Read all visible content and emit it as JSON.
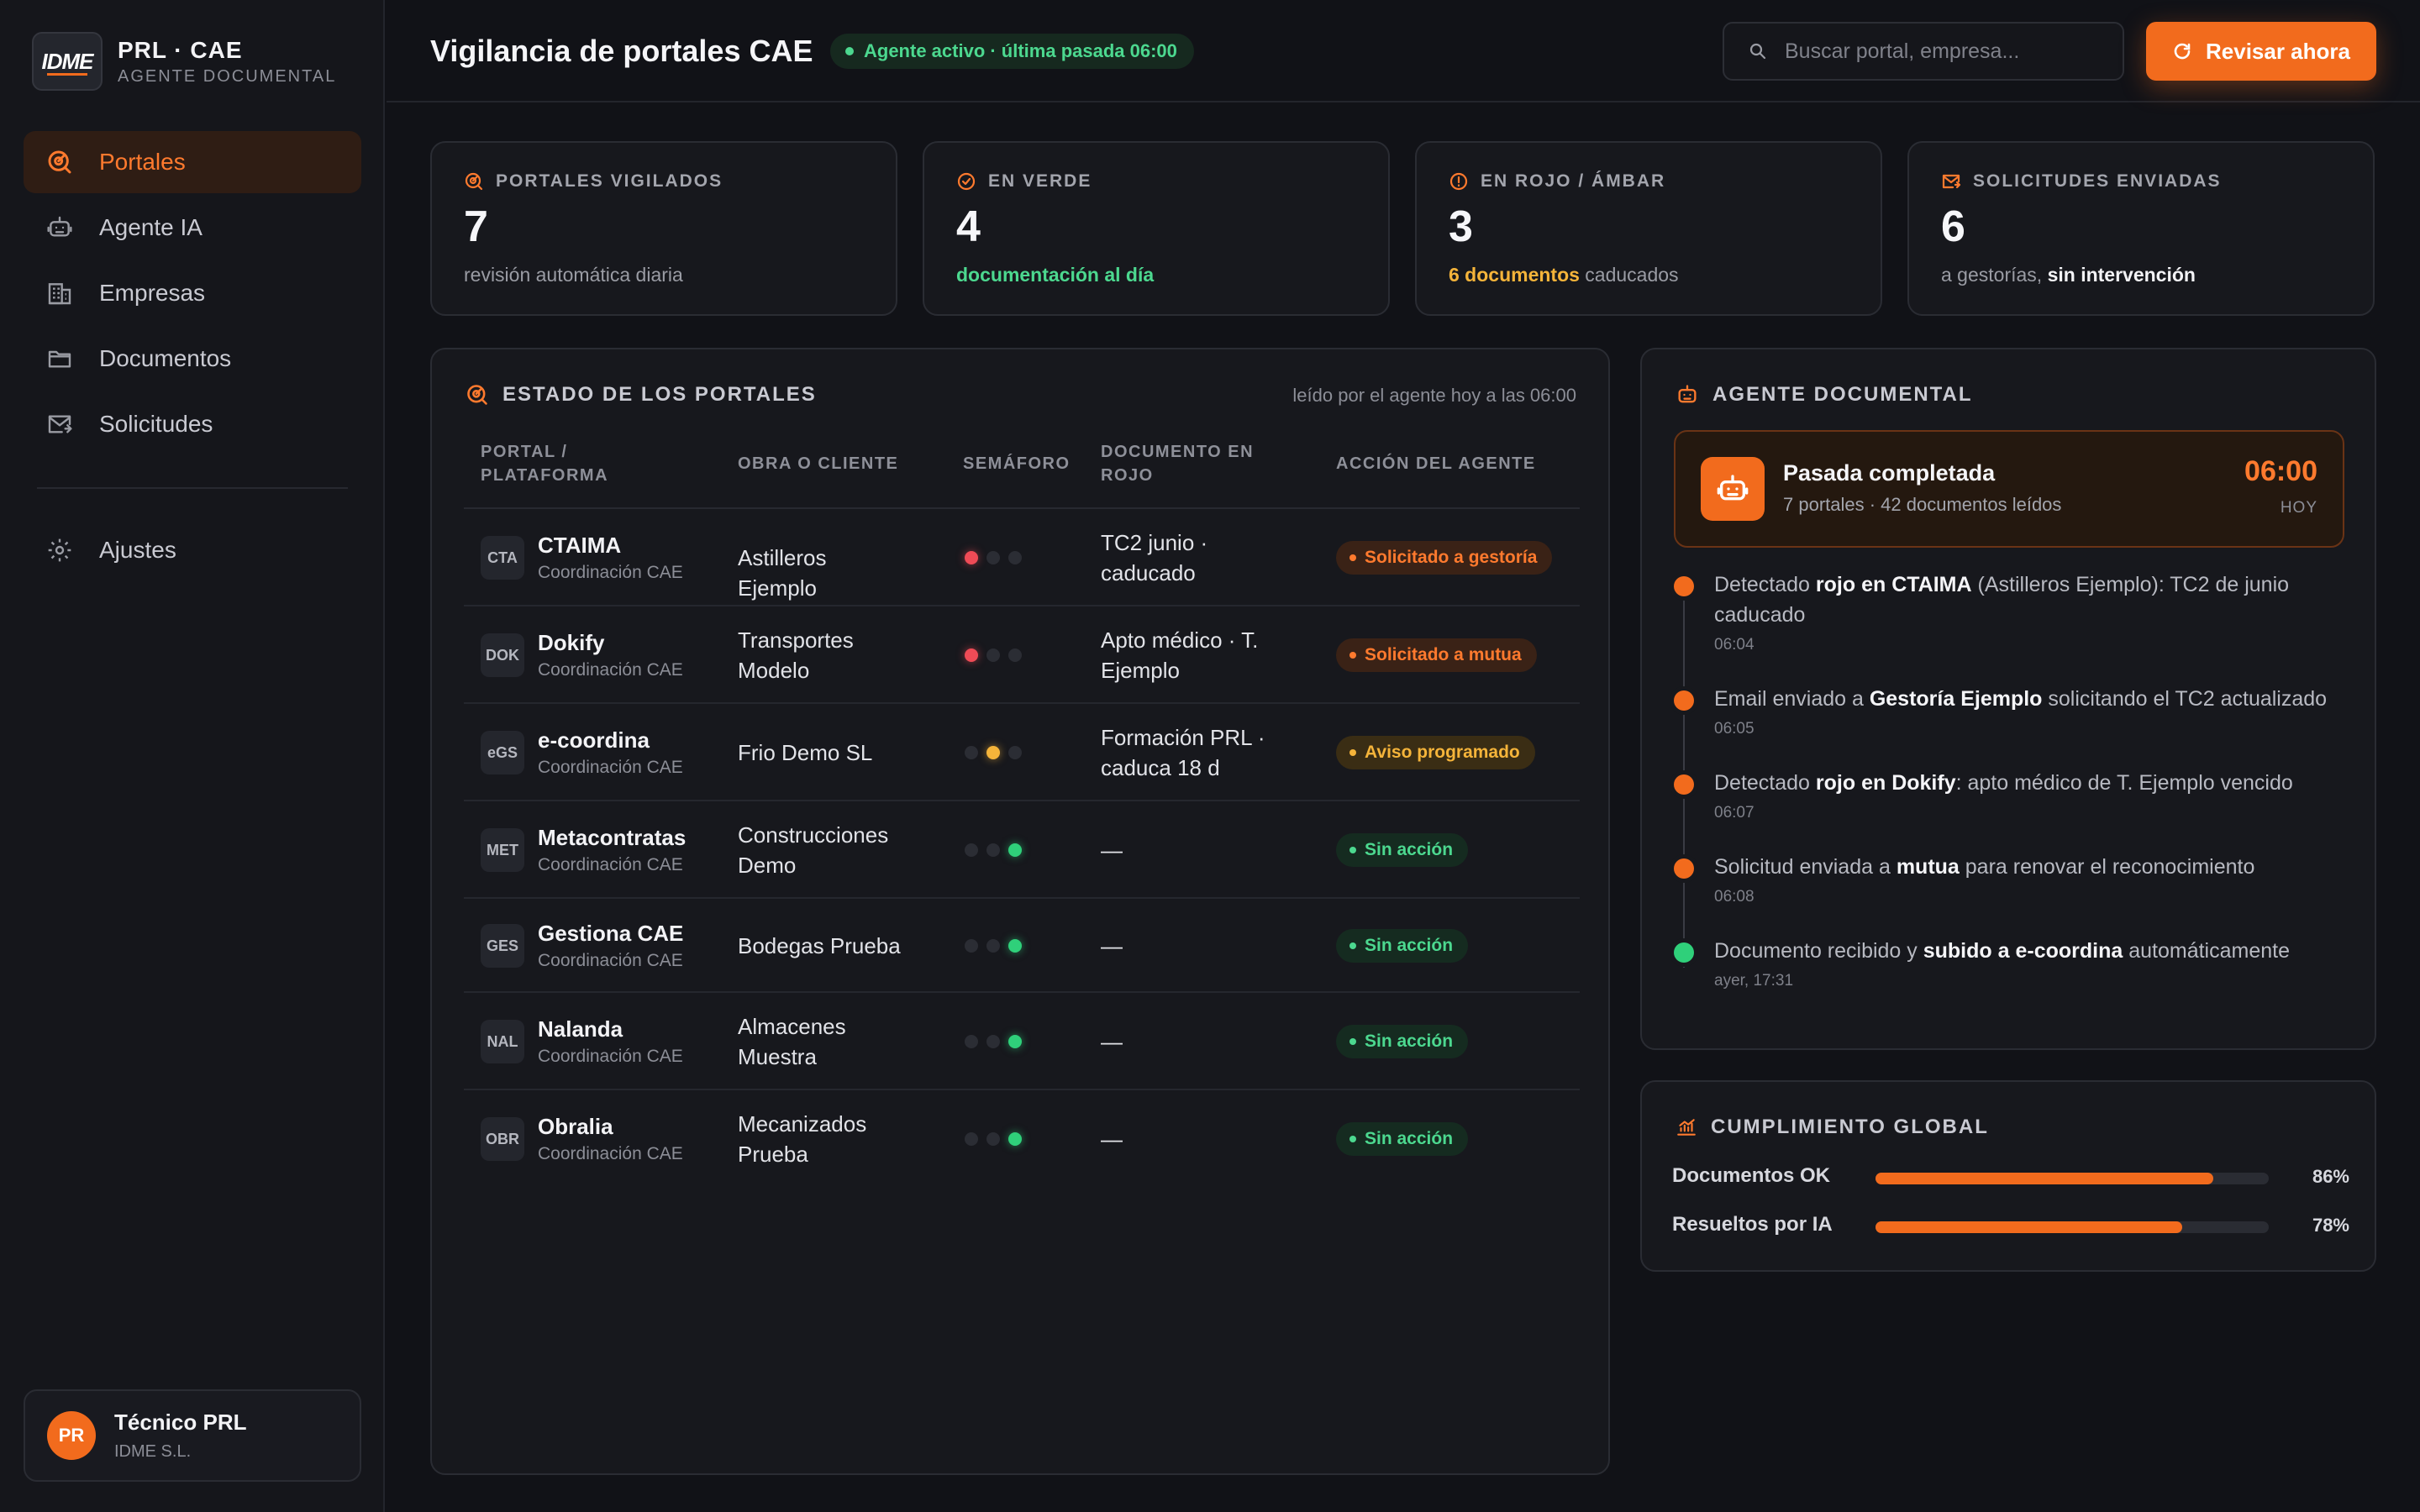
{
  "brand": {
    "logo": "IDME",
    "title": "PRL · CAE",
    "subtitle": "AGENTE DOCUMENTAL"
  },
  "sidebar": {
    "items": [
      {
        "label": "Portales",
        "icon": "radar-icon",
        "active": true
      },
      {
        "label": "Agente IA",
        "icon": "robot-icon"
      },
      {
        "label": "Empresas",
        "icon": "building-icon"
      },
      {
        "label": "Documentos",
        "icon": "folder-icon"
      },
      {
        "label": "Solicitudes",
        "icon": "mail-send-icon"
      }
    ],
    "settings_label": "Ajustes"
  },
  "user": {
    "initials": "PR",
    "name": "Técnico PRL",
    "org": "IDME S.L."
  },
  "header": {
    "title": "Vigilancia de portales CAE",
    "status": "Agente activo · última pasada 06:00",
    "search_placeholder": "Buscar portal, empresa...",
    "primary_action": "Revisar ahora"
  },
  "kpis": [
    {
      "label": "PORTALES VIGILADOS",
      "value": "7",
      "note": "revisión automática diaria"
    },
    {
      "label": "EN VERDE",
      "value": "4",
      "note": "documentación al día"
    },
    {
      "label": "EN ROJO / ÁMBAR",
      "value": "3",
      "note_strong": "6 documentos",
      "note_rest": " caducados"
    },
    {
      "label": "SOLICITUDES ENVIADAS",
      "value": "6",
      "note_rest": "a gestorías, ",
      "note_strong": "sin intervención"
    }
  ],
  "portals": {
    "title": "ESTADO DE LOS PORTALES",
    "meta": "leído por el agente hoy a las 06:00",
    "columns": {
      "portal_1": "PORTAL /",
      "portal_2": "PLATAFORMA",
      "client": "OBRA O CLIENTE",
      "light": "SEMÁFORO",
      "doc_1": "DOCUMENTO EN",
      "doc_2": "ROJO",
      "action": "ACCIÓN DEL AGENTE"
    },
    "rows": [
      {
        "code": "CTA",
        "name": "CTAIMA",
        "platform": "Coordinación CAE",
        "client": "Astilleros Ejemplo",
        "light": "red",
        "doc": "TC2 junio · caducado",
        "action": "Solicitado a gestoría",
        "action_tone": "orange"
      },
      {
        "code": "DOK",
        "name": "Dokify",
        "platform": "Coordinación CAE",
        "client": "Transportes Modelo",
        "light": "red",
        "doc": "Apto médico · T. Ejemplo",
        "action": "Solicitado a mutua",
        "action_tone": "orange"
      },
      {
        "code": "eGS",
        "name": "e-coordina",
        "platform": "Coordinación CAE",
        "client": "Frio Demo SL",
        "light": "amber",
        "doc": "Formación PRL · caduca 18 d",
        "action": "Aviso programado",
        "action_tone": "amber"
      },
      {
        "code": "MET",
        "name": "Metacontratas",
        "platform": "Coordinación CAE",
        "client": "Construcciones Demo",
        "light": "green",
        "doc": "—",
        "action": "Sin acción",
        "action_tone": "green"
      },
      {
        "code": "GES",
        "name": "Gestiona CAE",
        "platform": "Coordinación CAE",
        "client": "Bodegas Prueba",
        "light": "green",
        "doc": "—",
        "action": "Sin acción",
        "action_tone": "green"
      },
      {
        "code": "NAL",
        "name": "Nalanda",
        "platform": "Coordinación CAE",
        "client": "Almacenes Muestra",
        "light": "green",
        "doc": "—",
        "action": "Sin acción",
        "action_tone": "green"
      },
      {
        "code": "OBR",
        "name": "Obralia",
        "platform": "Coordinación CAE",
        "client": "Mecanizados Prueba",
        "light": "green",
        "doc": "—",
        "action": "Sin acción",
        "action_tone": "green"
      }
    ]
  },
  "agent": {
    "title": "AGENTE DOCUMENTAL",
    "pass_title": "Pasada completada",
    "pass_sub": "7 portales · 42 documentos leídos",
    "pass_time": "06:00",
    "pass_day": "HOY",
    "events": [
      {
        "a": "Detectado ",
        "b": "rojo en CTAIMA",
        "c": " (Astilleros Ejemplo): TC2 de junio caducado",
        "time": "06:04",
        "ok": false
      },
      {
        "a": "Email enviado a ",
        "b": "Gestoría Ejemplo",
        "c": " solicitando el TC2 actualizado",
        "time": "06:05",
        "ok": false
      },
      {
        "a": "Detectado ",
        "b": "rojo en Dokify",
        "c": ": apto médico de T. Ejemplo vencido",
        "time": "06:07",
        "ok": false
      },
      {
        "a": "Solicitud enviada a ",
        "b": "mutua",
        "c": " para renovar el reconocimiento",
        "time": "06:08",
        "ok": false
      },
      {
        "a": "Documento recibido y ",
        "b": "subido a e-coordina",
        "c": " automáticamente",
        "time": "ayer, 17:31",
        "ok": true
      }
    ]
  },
  "compliance": {
    "title": "CUMPLIMIENTO GLOBAL",
    "bars": [
      {
        "label": "Documentos OK",
        "value": 86,
        "pct": "86%"
      },
      {
        "label": "Resueltos por IA",
        "value": 78,
        "pct": "78%"
      }
    ]
  },
  "colors": {
    "accent": "#f26b1d",
    "green": "#2fd07a",
    "red": "#ef4b56",
    "amber": "#f5b43a"
  }
}
